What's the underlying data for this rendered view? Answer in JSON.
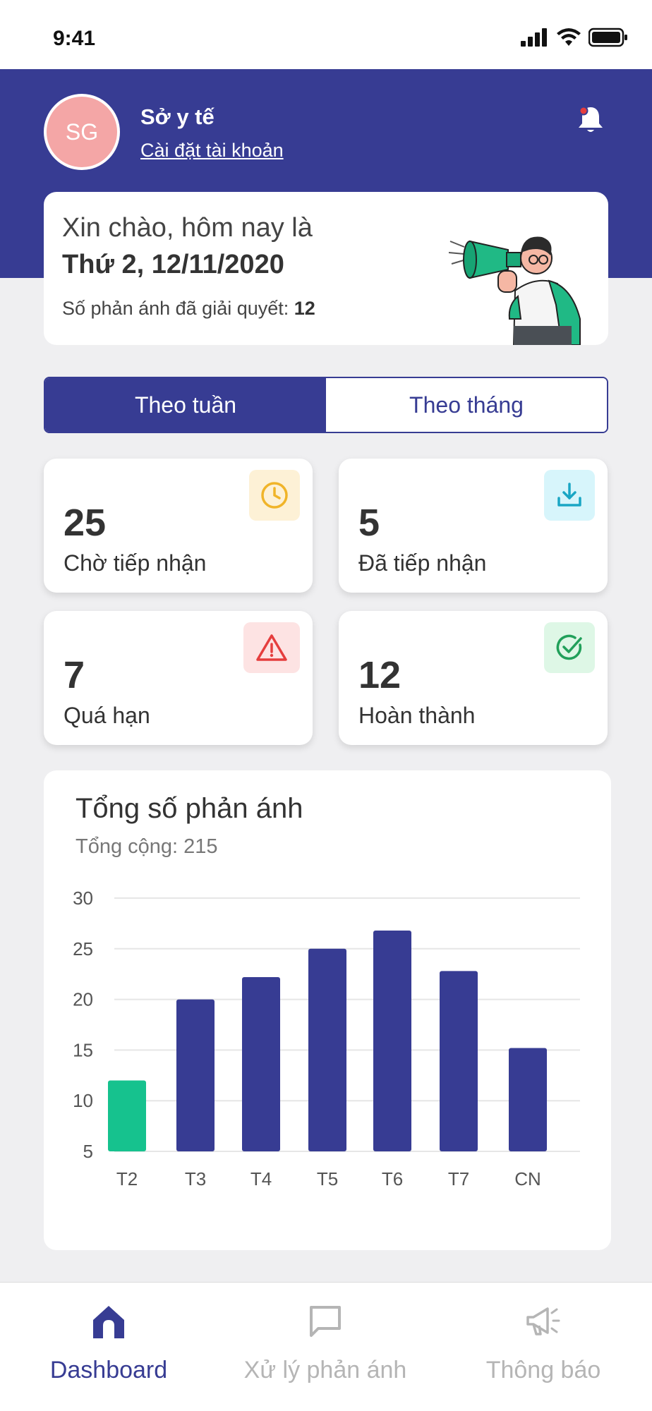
{
  "status_bar": {
    "time": "9:41"
  },
  "header": {
    "avatar_initials": "SG",
    "org_name": "Sở y tế",
    "account_link": "Cài đặt tài khoản",
    "bell_icon": "bell-icon"
  },
  "greeting": {
    "line1": "Xin chào, hôm nay là",
    "date": "Thứ 2, 12/11/2020",
    "resolved_label": "Số phản ánh đã giải quyết:",
    "resolved_count": "12"
  },
  "segmented": {
    "weekly": "Theo tuần",
    "monthly": "Theo tháng",
    "selected": "weekly"
  },
  "stats": [
    {
      "value": "25",
      "label": "Chờ tiếp nhận",
      "icon": "clock-icon",
      "color": "#f0b429",
      "bg": "#fdf1d6"
    },
    {
      "value": "5",
      "label": "Đã tiếp nhận",
      "icon": "download-icon",
      "color": "#1aa6c4",
      "bg": "#d7f5fb"
    },
    {
      "value": "7",
      "label": "Quá hạn",
      "icon": "warning-icon",
      "color": "#e53e3e",
      "bg": "#fde3e3"
    },
    {
      "value": "12",
      "label": "Hoàn thành",
      "icon": "check-circle-icon",
      "color": "#21a05a",
      "bg": "#def7e6"
    }
  ],
  "chart_data": {
    "type": "bar",
    "title": "Tổng số phản ánh",
    "subtitle": "Tổng cộng: 215",
    "categories": [
      "T2",
      "T3",
      "T4",
      "T5",
      "T6",
      "T7",
      "CN"
    ],
    "values": [
      12,
      20,
      22.2,
      25,
      26.8,
      22.8,
      15.2
    ],
    "ylim": [
      5,
      30
    ],
    "yticks": [
      "30",
      "25",
      "20",
      "15",
      "10",
      "5"
    ],
    "highlight_index": 0,
    "bar_color": "#373c93",
    "highlight_color": "#16c28e",
    "grid": true
  },
  "tabbar": {
    "items": [
      {
        "label": "Dashboard",
        "icon": "home-icon",
        "active": true
      },
      {
        "label": "Xử lý phản ánh",
        "icon": "chat-icon",
        "active": false
      },
      {
        "label": "Thông báo",
        "icon": "megaphone-icon",
        "active": false
      }
    ],
    "active_color": "#373c93",
    "inactive_color": "#b5b5b5"
  }
}
